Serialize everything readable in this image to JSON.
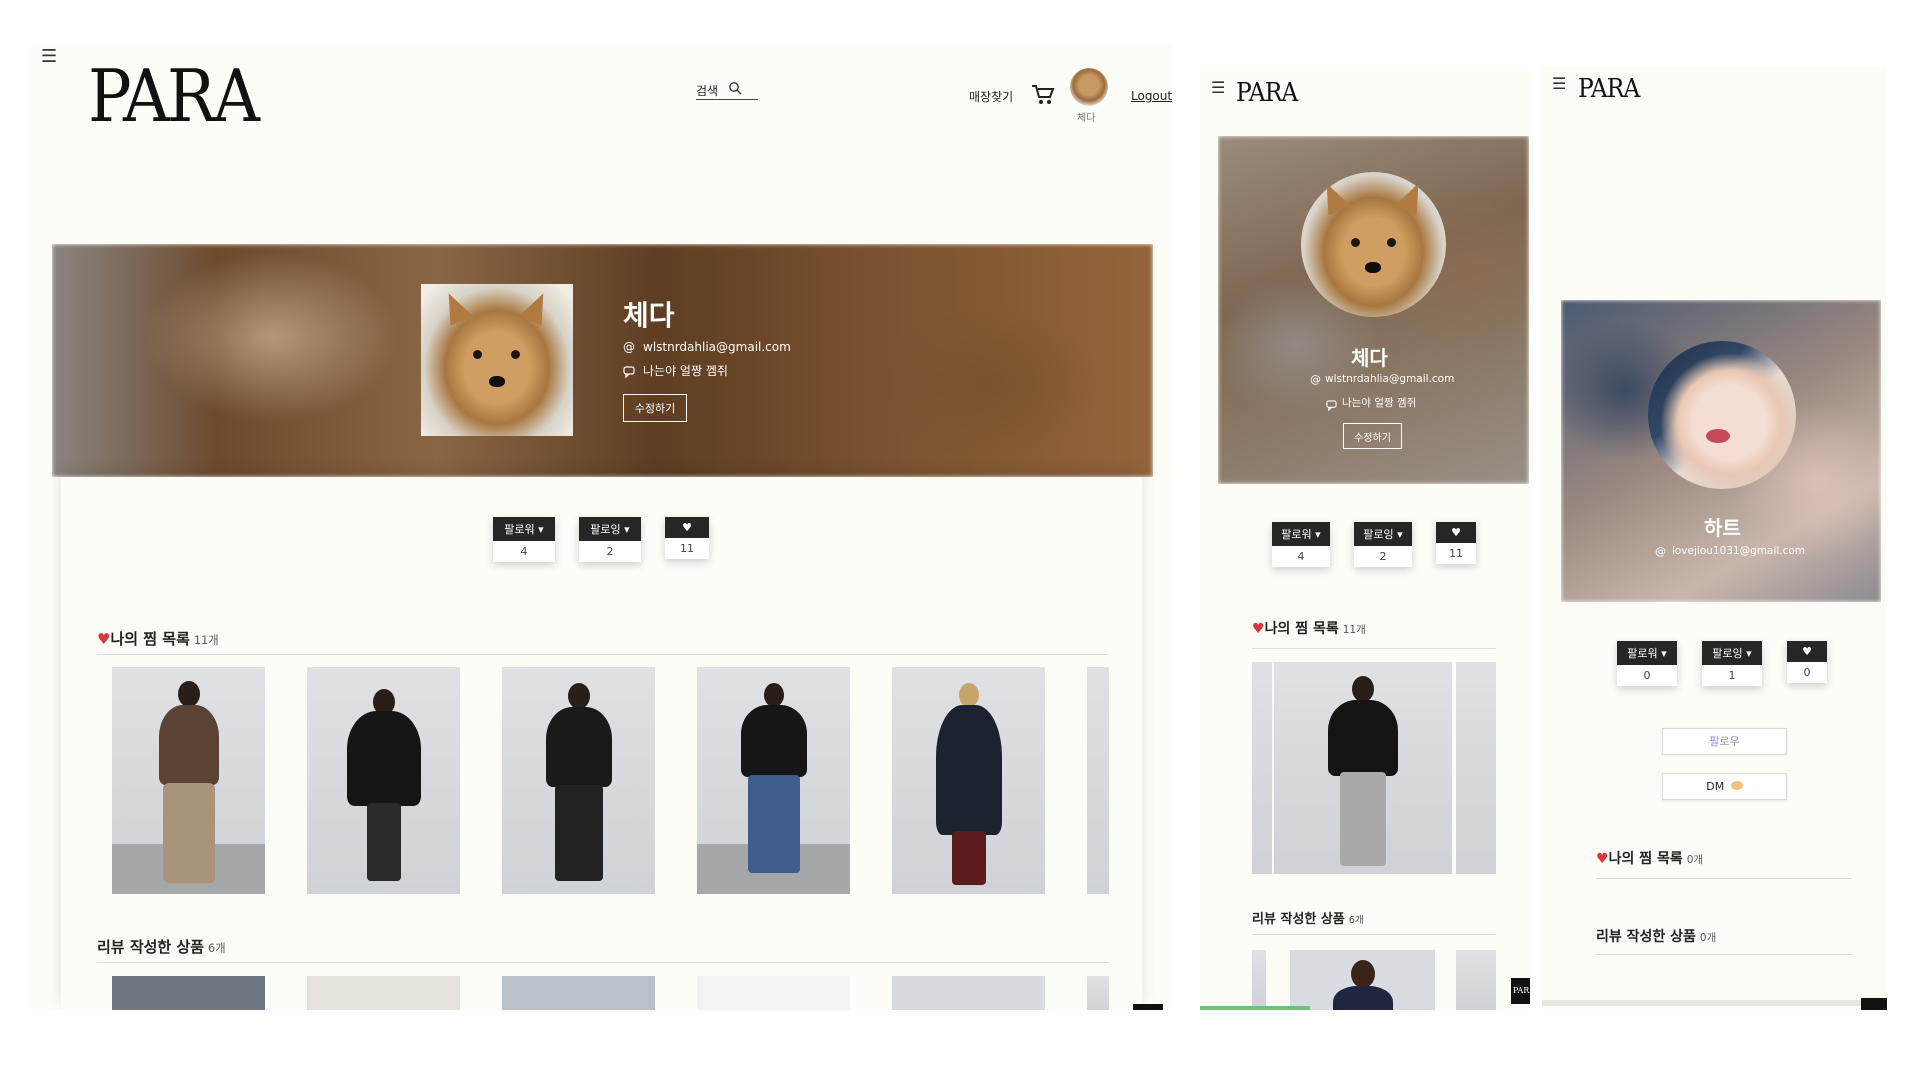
{
  "desktop": {
    "logo": "PARA",
    "search_label": "검색",
    "store_label": "매장찾기",
    "avatar_caption": "체다",
    "logout_label": "Logout",
    "profile": {
      "name": "체다",
      "email": "wlstnrdahlia@gmail.com",
      "bio": "나는야 얼짱 껨쥐",
      "edit_label": "수정하기"
    },
    "stats": {
      "followers_label": "팔로워",
      "followers_count": "4",
      "following_label": "팔로잉",
      "following_count": "2",
      "likes_count": "11"
    },
    "wishlist": {
      "title": "나의 찜 목록",
      "count": "11개"
    },
    "reviews": {
      "title": "리뷰 작성한 상품",
      "count": "6개"
    }
  },
  "tablet": {
    "logo": "PARA",
    "profile": {
      "name": "체다",
      "email": "wlstnrdahlia@gmail.com",
      "bio": "나는야 얼짱 껨쥐",
      "edit_label": "수정하기"
    },
    "stats": {
      "followers_label": "팔로워",
      "followers_count": "4",
      "following_label": "팔로잉",
      "following_count": "2",
      "likes_count": "11"
    },
    "wishlist": {
      "title": "나의 찜 목록",
      "count": "11개"
    },
    "reviews": {
      "title": "리뷰 작성한 상품",
      "count": "6개"
    },
    "corner_badge": "PARA"
  },
  "other_user": {
    "logo": "PARA",
    "profile": {
      "name": "하트",
      "email": "lovejiou1031@gmail.com"
    },
    "stats": {
      "followers_label": "팔로워",
      "followers_count": "0",
      "following_label": "팔로잉",
      "following_count": "1",
      "likes_count": "0"
    },
    "follow_label": "팔로우",
    "dm_label": "DM",
    "wishlist": {
      "title": "나의 찜 목록",
      "count": "0개"
    },
    "reviews": {
      "title": "리뷰 작성한 상품",
      "count": "0개"
    }
  },
  "icons": {
    "menu": "hamburger-icon",
    "search": "search-icon",
    "cart": "cart-icon",
    "at": "at-icon",
    "speech": "speech-bubble-icon",
    "heart": "heart-icon",
    "chevron": "chevron-icon"
  },
  "colors": {
    "page_bg": "#fdfdf8",
    "stat_button": "#262626",
    "heart": "#d9363e",
    "banner_brown": "#7a5230"
  }
}
